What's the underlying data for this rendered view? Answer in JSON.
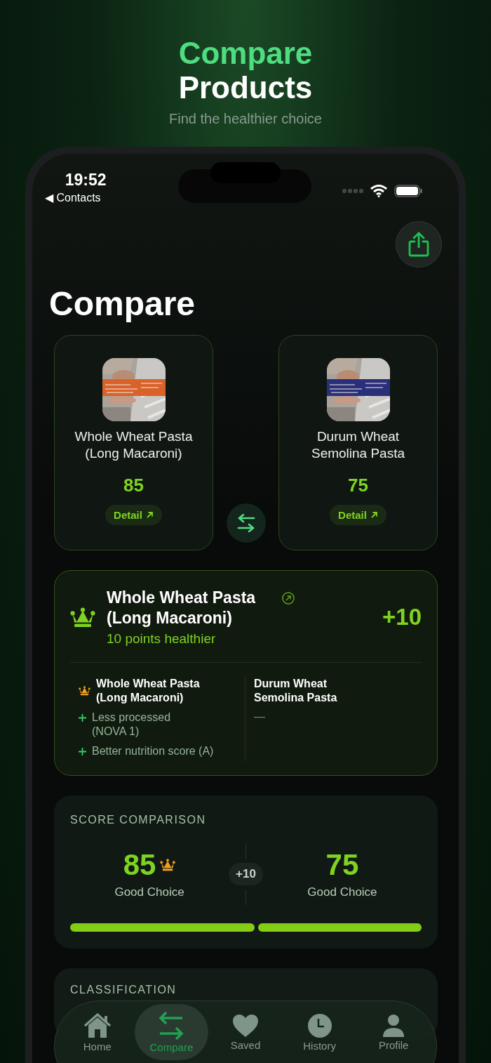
{
  "header": {
    "title_accent": "Compare",
    "title": "Products",
    "subtitle": "Find the healthier choice"
  },
  "status_bar": {
    "time": "19:52",
    "back": "◀ Contacts"
  },
  "page_title": "Compare",
  "products": [
    {
      "name": "Whole Wheat Pasta (Long Macaroni)",
      "score": "85",
      "detail": "Detail"
    },
    {
      "name": "Durum Wheat Semolina Pasta",
      "score": "75",
      "detail": "Detail"
    }
  ],
  "winner": {
    "name": "Whole Wheat Pasta (Long Macaroni)",
    "subtitle": "10 points healthier",
    "difference": "+10",
    "columns": [
      {
        "name": "Whole Wheat Pasta (Long Macaroni)",
        "winner": true,
        "points": [
          "Less processed (NOVA 1)",
          "Better nutrition score (A)"
        ]
      },
      {
        "name": "Durum Wheat Semolina Pasta",
        "winner": false,
        "empty": "—"
      }
    ]
  },
  "score_comparison": {
    "title": "SCORE COMPARISON",
    "difference": "+10",
    "scores": [
      {
        "value": "85",
        "label": "Good Choice",
        "winner": true
      },
      {
        "value": "75",
        "label": "Good Choice",
        "winner": false
      }
    ]
  },
  "classification": {
    "title": "CLASSIFICATION"
  },
  "tabs": [
    {
      "label": "Home",
      "selected": false
    },
    {
      "label": "Compare",
      "selected": true
    },
    {
      "label": "Saved",
      "selected": false
    },
    {
      "label": "History",
      "selected": false
    },
    {
      "label": "Profile",
      "selected": false
    }
  ]
}
